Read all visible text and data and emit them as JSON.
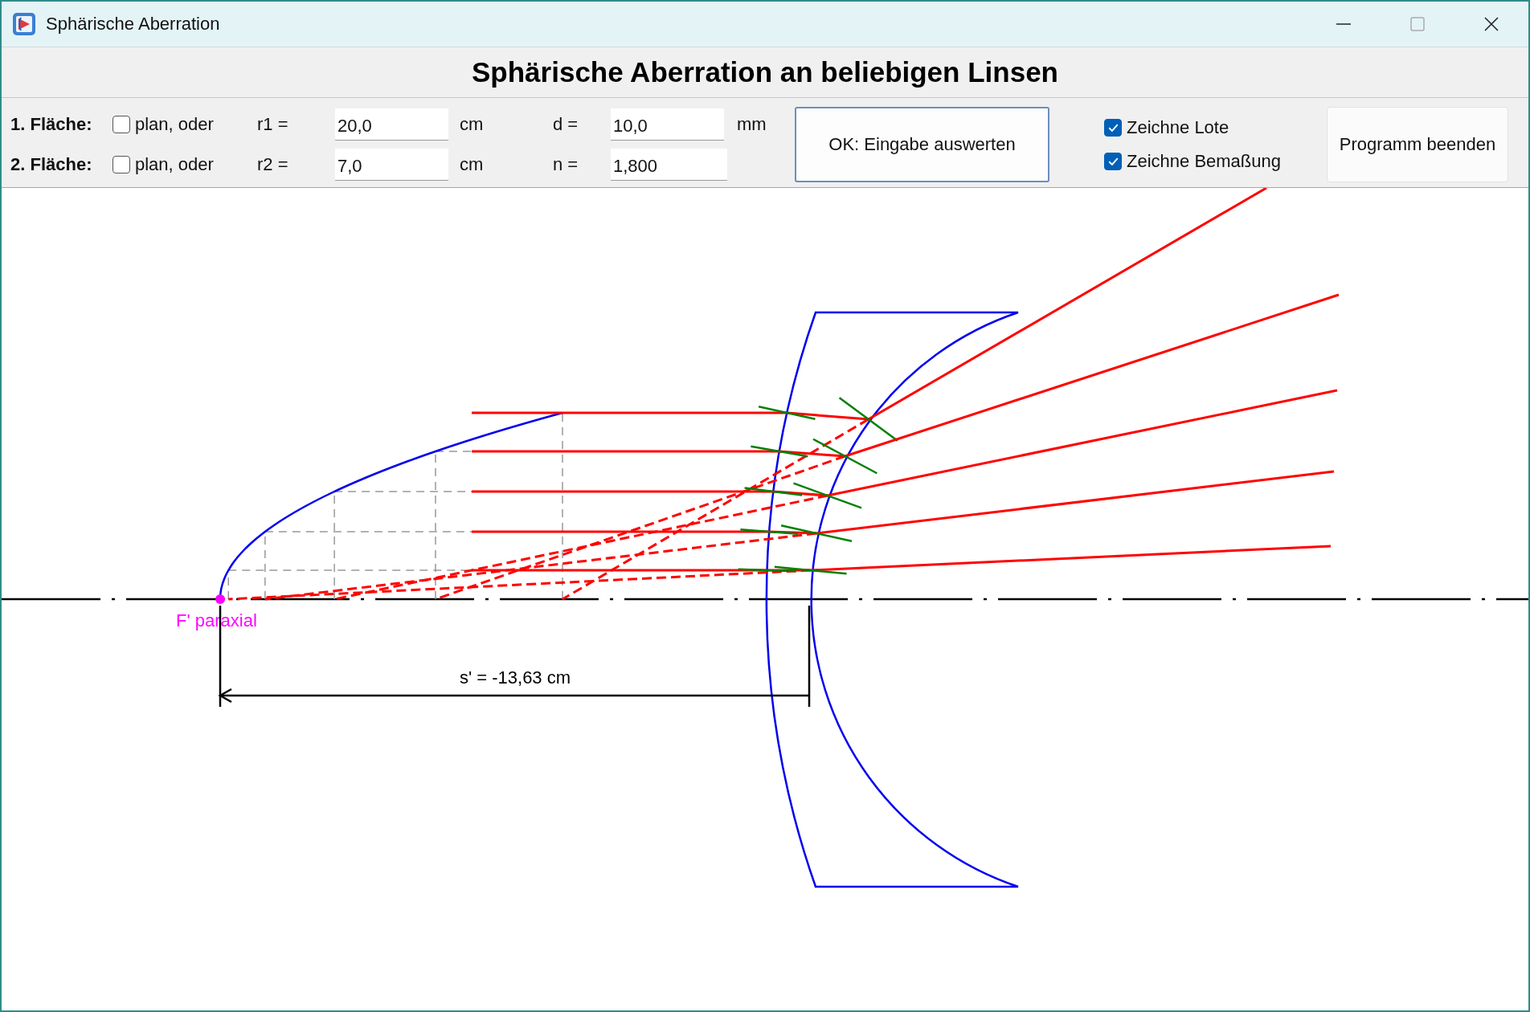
{
  "window": {
    "title": "Sphärische Aberration"
  },
  "heading": "Sphärische Aberration an beliebigen Linsen",
  "surfaces": [
    {
      "label": "1. Fläche:",
      "plan": {
        "label": "plan, oder",
        "checked": false
      },
      "radius": {
        "label": "r1 =",
        "value": "20,0",
        "unit": "cm"
      }
    },
    {
      "label": "2. Fläche:",
      "plan": {
        "label": "plan, oder",
        "checked": false
      },
      "radius": {
        "label": "r2 =",
        "value": "7,0",
        "unit": "cm"
      }
    }
  ],
  "thickness": {
    "label": "d =",
    "value": "10,0",
    "unit": "mm"
  },
  "index": {
    "label": "n =",
    "value": "1,800"
  },
  "evaluate_button": "OK: Eingabe auswerten",
  "options": [
    {
      "label": "Zeichne Lote",
      "checked": true
    },
    {
      "label": "Zeichne Bemaßung",
      "checked": true
    }
  ],
  "quit_button": "Programm beenden",
  "diagram": {
    "focus_label": "F' paraxial",
    "dimension_label": "s' = -13,63 cm"
  }
}
